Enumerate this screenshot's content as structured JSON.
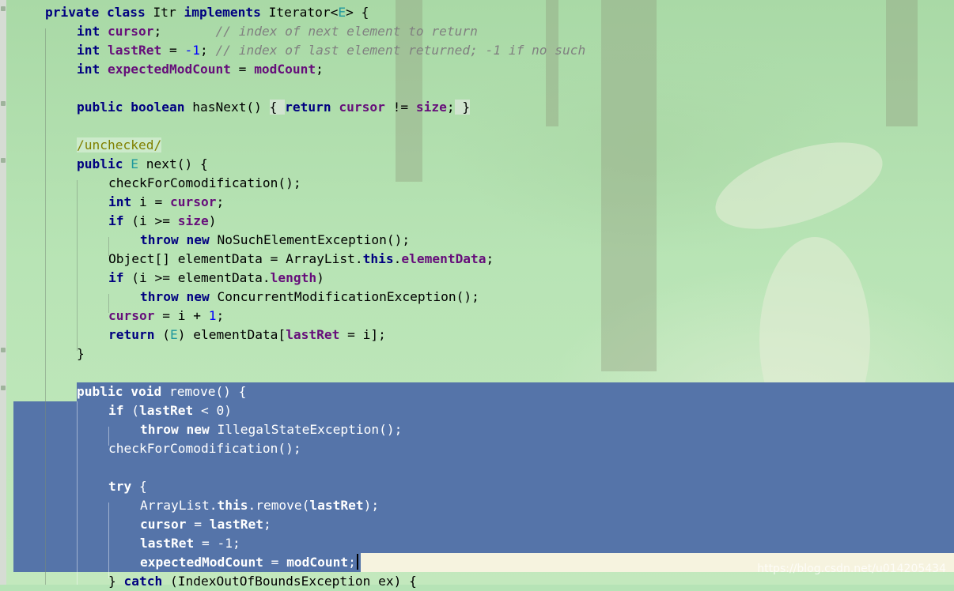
{
  "watermark": "https://blog.csdn.net/u014205434",
  "code": {
    "class_decl": {
      "kw_private": "private",
      "kw_class": "class",
      "name": " Itr ",
      "kw_implements": "implements",
      "iface": " Iterator<",
      "tparam": "E",
      "close": "> {"
    },
    "cursor_decl": {
      "type": "int",
      "name": "cursor",
      "rest": ";",
      "comment": "// index of next element to return"
    },
    "lastret_decl": {
      "type": "int",
      "name": "lastRet",
      "eq": " = ",
      "value": "-1",
      "semi": ";",
      "comment": "// index of last element returned; -1 if no such"
    },
    "expected_decl": {
      "type": "int",
      "name": "expectedModCount",
      "eq": " = ",
      "value": "modCount",
      "semi": ";"
    },
    "hasnext": {
      "kw_public": "public",
      "kw_boolean": "boolean",
      "sig": " hasNext() ",
      "open": "{ ",
      "kw_return": "return",
      "f_cursor": "cursor",
      "ne": " != ",
      "f_size": "size",
      "semi": ";",
      "close": " }"
    },
    "annotation": "/unchecked/",
    "next_decl": {
      "kw_public": "public",
      "tparam": "E",
      "sig": " next() {"
    },
    "check1": "checkForComodification();",
    "int_i": {
      "type": "int",
      "mid": " i = ",
      "f": "cursor",
      "semi": ";"
    },
    "if_size": {
      "kw": "if",
      "mid": " (i >= ",
      "f": "size",
      "close": ")"
    },
    "throw_nse": {
      "kw_throw": "throw",
      "kw_new": "new",
      "rest": " NoSuchElementException();"
    },
    "obj_line": {
      "pre": "Object[] elementData = ArrayList.",
      "kw_this": "this",
      "dot": ".",
      "f": "elementData",
      "semi": ";"
    },
    "if_len": {
      "kw": "if",
      "mid": " (i >= elementData.",
      "f": "length",
      "close": ")"
    },
    "throw_cme": {
      "kw_throw": "throw",
      "kw_new": "new",
      "rest": " ConcurrentModificationException();"
    },
    "cursor_inc": {
      "f": "cursor",
      "mid": " = i + ",
      "num": "1",
      "semi": ";"
    },
    "return_line": {
      "kw": "return",
      "open": " (",
      "tparam": "E",
      "mid": ") elementData[",
      "f": "lastRet",
      "rest": " = i];"
    },
    "close_brace": "}",
    "remove_decl": {
      "kw_public": "public",
      "kw_void": "void",
      "sig": " remove() {"
    },
    "if_lastret": {
      "kw": "if",
      "open": " (",
      "f": "lastRet",
      "rest": " < 0)"
    },
    "throw_ise": {
      "kw_throw": "throw",
      "kw_new": "new",
      "rest": " IllegalStateException();"
    },
    "check2": "checkForComodification();",
    "try_line": {
      "kw": "try",
      "rest": " {"
    },
    "al_remove": {
      "pre": "ArrayList.",
      "kw_this": "this",
      "mid": ".remove(",
      "f": "lastRet",
      "close": ");"
    },
    "cursor_eq": {
      "f": "cursor",
      "mid": " = ",
      "f2": "lastRet",
      "semi": ";"
    },
    "lastret_reset": {
      "f": "lastRet",
      "rest": " = -1;"
    },
    "expected_eq": {
      "f": "expectedModCount",
      "mid": " = ",
      "f2": "modCount",
      "semi": ";"
    },
    "catch_line": {
      "pre": "} ",
      "kw": "catch",
      "rest": " (IndexOutOfBoundsException ex) {"
    }
  }
}
